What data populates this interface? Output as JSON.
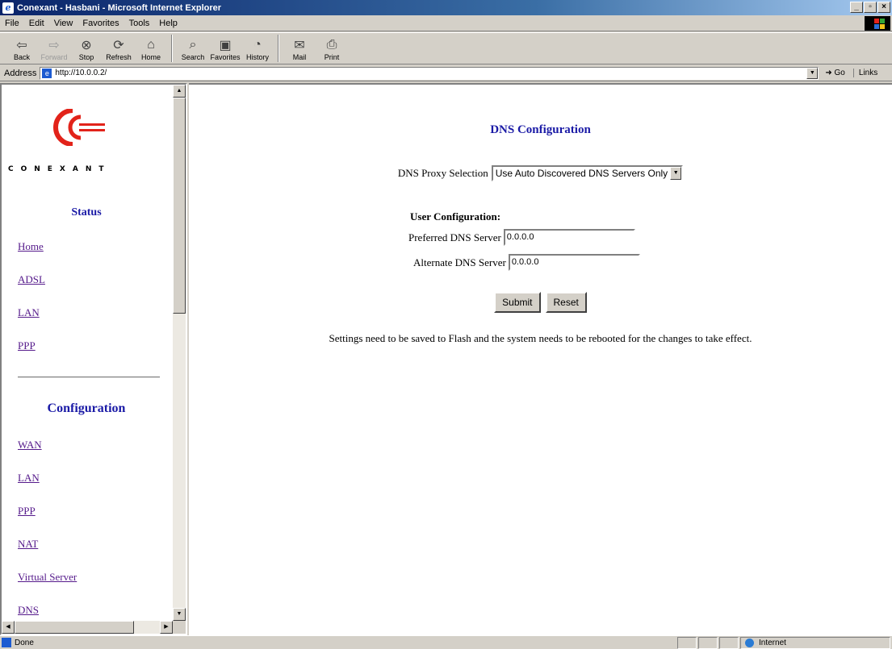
{
  "window": {
    "title": "Conexant - Hasbani - Microsoft Internet Explorer"
  },
  "menu": [
    "File",
    "Edit",
    "View",
    "Favorites",
    "Tools",
    "Help"
  ],
  "toolbar": {
    "back": "Back",
    "forward": "Forward",
    "stop": "Stop",
    "refresh": "Refresh",
    "home": "Home",
    "search": "Search",
    "favorites": "Favorites",
    "history": "History",
    "mail": "Mail",
    "print": "Print"
  },
  "address": {
    "label": "Address",
    "url": "http://10.0.0.2/",
    "go": "Go",
    "links": "Links"
  },
  "sidebar": {
    "brand": "CONEXANT",
    "status_heading": "Status",
    "status_links": [
      "Home",
      "ADSL",
      "LAN",
      "PPP"
    ],
    "config_heading": "Configuration",
    "config_links": [
      "WAN",
      "LAN",
      "PPP",
      "NAT",
      "Virtual Server",
      "DNS"
    ]
  },
  "main": {
    "title": "DNS Configuration",
    "proxy_label": "DNS Proxy Selection",
    "proxy_selected": "Use Auto Discovered DNS Servers Only",
    "user_config_heading": "User Configuration:",
    "preferred_label": "Preferred DNS Server",
    "preferred_value": "0.0.0.0",
    "alternate_label": "Alternate DNS Server",
    "alternate_value": "0.0.0.0",
    "submit_label": "Submit",
    "reset_label": "Reset",
    "note": "Settings need to be saved to Flash and the system needs to be rebooted for the changes to take effect."
  },
  "statusbar": {
    "status": "Done",
    "zone": "Internet"
  },
  "colors": {
    "heading_blue": "#1a1aa6",
    "visited_link": "#551a8b",
    "logo_red": "#e2231a"
  }
}
